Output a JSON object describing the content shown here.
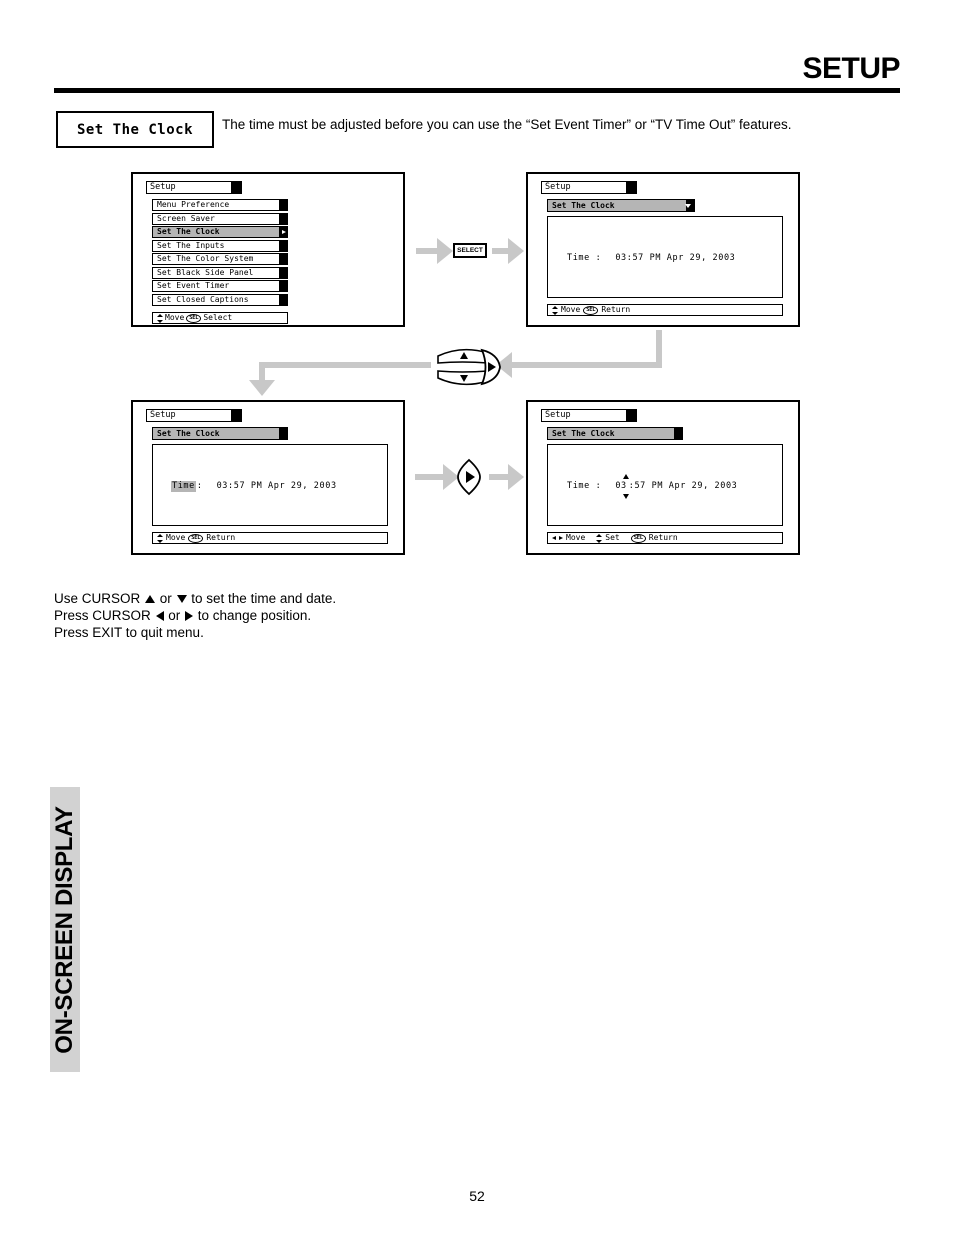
{
  "header": {
    "title": "SETUP"
  },
  "section": {
    "label": "Set The Clock",
    "intro": "The time must be adjusted before you can use the “Set Event Timer” or “TV Time Out” features."
  },
  "controls": {
    "select_button": "SELECT"
  },
  "osd": {
    "panel1": {
      "title": "Setup",
      "items": [
        {
          "label": "Menu Preference",
          "selected": false
        },
        {
          "label": "Screen Saver",
          "selected": false
        },
        {
          "label": "Set The Clock",
          "selected": true
        },
        {
          "label": "Set The Inputs",
          "selected": false
        },
        {
          "label": "Set The Color System",
          "selected": false
        },
        {
          "label": "Set Black Side Panel",
          "selected": false
        },
        {
          "label": "Set Event Timer",
          "selected": false
        },
        {
          "label": "Set Closed Captions",
          "selected": false
        }
      ],
      "footer": {
        "move": "Move",
        "sel": "SEL",
        "action": "Select"
      }
    },
    "panel2": {
      "title": "Setup",
      "submenu": "Set The Clock",
      "time_label": "Time :",
      "time_value": "03:57 PM Apr 29, 2003",
      "footer": {
        "move": "Move",
        "sel": "SEL",
        "action": "Return"
      }
    },
    "panel3": {
      "title": "Setup",
      "submenu": "Set The Clock",
      "time_label": "Time",
      "time_sep": ":",
      "time_value": "03:57 PM Apr 29, 2003",
      "footer": {
        "move": "Move",
        "sel": "SEL",
        "action": "Return"
      }
    },
    "panel4": {
      "title": "Setup",
      "submenu": "Set The Clock",
      "time_label": "Time :",
      "time_field": "03",
      "time_rest": ":57 PM Apr 29, 2003",
      "footer": {
        "move": "Move",
        "set": "Set",
        "sel": "SEL",
        "action": "Return"
      }
    }
  },
  "instructions": {
    "line1_a": "Use CURSOR ",
    "line1_b": " or ",
    "line1_c": " to set the time and date.",
    "line2_a": "Press CURSOR ",
    "line2_b": " or ",
    "line2_c": " to change position.",
    "line3": "Press EXIT to quit menu."
  },
  "side_tab": {
    "label": "ON-SCREEN DISPLAY"
  },
  "page": {
    "number": "52"
  }
}
